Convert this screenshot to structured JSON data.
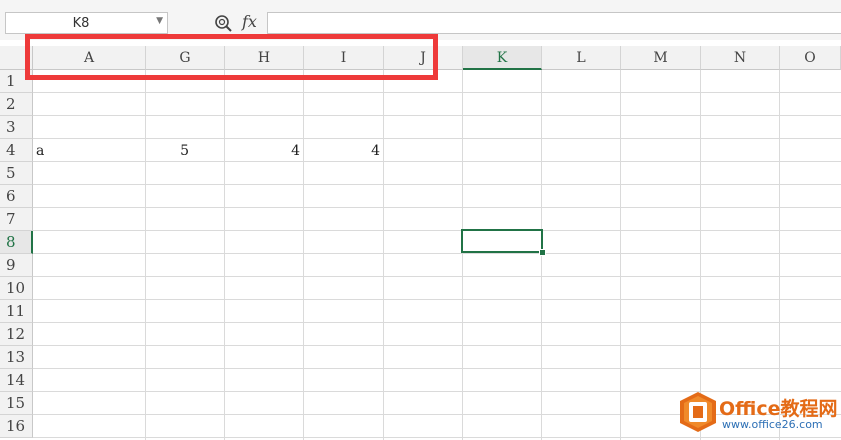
{
  "name_box": {
    "value": "K8"
  },
  "formula_bar": {
    "fx_label": "fx",
    "value": ""
  },
  "columns": [
    "A",
    "G",
    "H",
    "I",
    "J",
    "K",
    "L",
    "M",
    "N",
    "O"
  ],
  "active_column": "K",
  "rows": [
    "1",
    "2",
    "3",
    "4",
    "5",
    "6",
    "7",
    "8",
    "9",
    "10",
    "11",
    "12",
    "13",
    "14",
    "15",
    "16"
  ],
  "active_row": "8",
  "cells": {
    "A4": "a",
    "G4": "5",
    "H4": "4",
    "I4": "4"
  },
  "colors": {
    "accent": "#217346",
    "highlight_box": "#ee3a3a",
    "watermark_orange": "#e46b17",
    "watermark_blue": "#2c6fb5"
  },
  "watermark": {
    "brand": "Office教程网",
    "url": "www.office26.com"
  }
}
